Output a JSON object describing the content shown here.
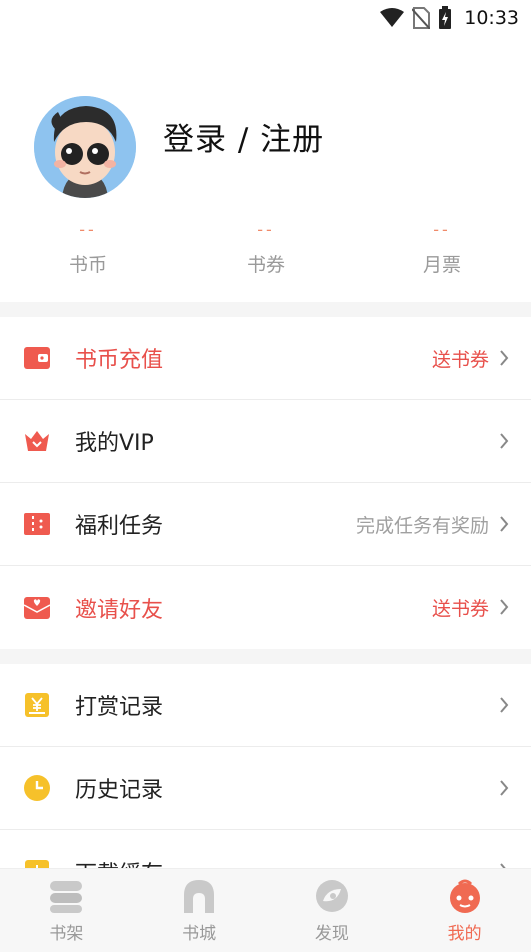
{
  "status_bar": {
    "time": "10:33"
  },
  "profile": {
    "login_label": "登录 / 注册",
    "stats": [
      {
        "value": "--",
        "label": "书币"
      },
      {
        "value": "--",
        "label": "书券"
      },
      {
        "value": "--",
        "label": "月票"
      }
    ]
  },
  "menu_group_1": [
    {
      "title": "书币充值",
      "extra": "送书券",
      "icon": "wallet-icon"
    },
    {
      "title": "我的VIP",
      "extra": "",
      "icon": "crown-icon"
    },
    {
      "title": "福利任务",
      "extra": "完成任务有奖励",
      "icon": "ticket-icon"
    },
    {
      "title": "邀请好友",
      "extra": "送书券",
      "icon": "envelope-heart-icon"
    }
  ],
  "menu_group_2": [
    {
      "title": "打赏记录",
      "icon": "yen-box-icon"
    },
    {
      "title": "历史记录",
      "icon": "clock-icon"
    },
    {
      "title": "下载缓存",
      "icon": "download-icon"
    }
  ],
  "tabbar": [
    {
      "label": "书架",
      "icon": "bookshelf-icon"
    },
    {
      "label": "书城",
      "icon": "bookstore-icon"
    },
    {
      "label": "发现",
      "icon": "discover-icon"
    },
    {
      "label": "我的",
      "icon": "mine-icon"
    }
  ],
  "colors": {
    "accent_red": "#e8504b",
    "accent_orange": "#f06a52",
    "yellow": "#f6c12a"
  }
}
